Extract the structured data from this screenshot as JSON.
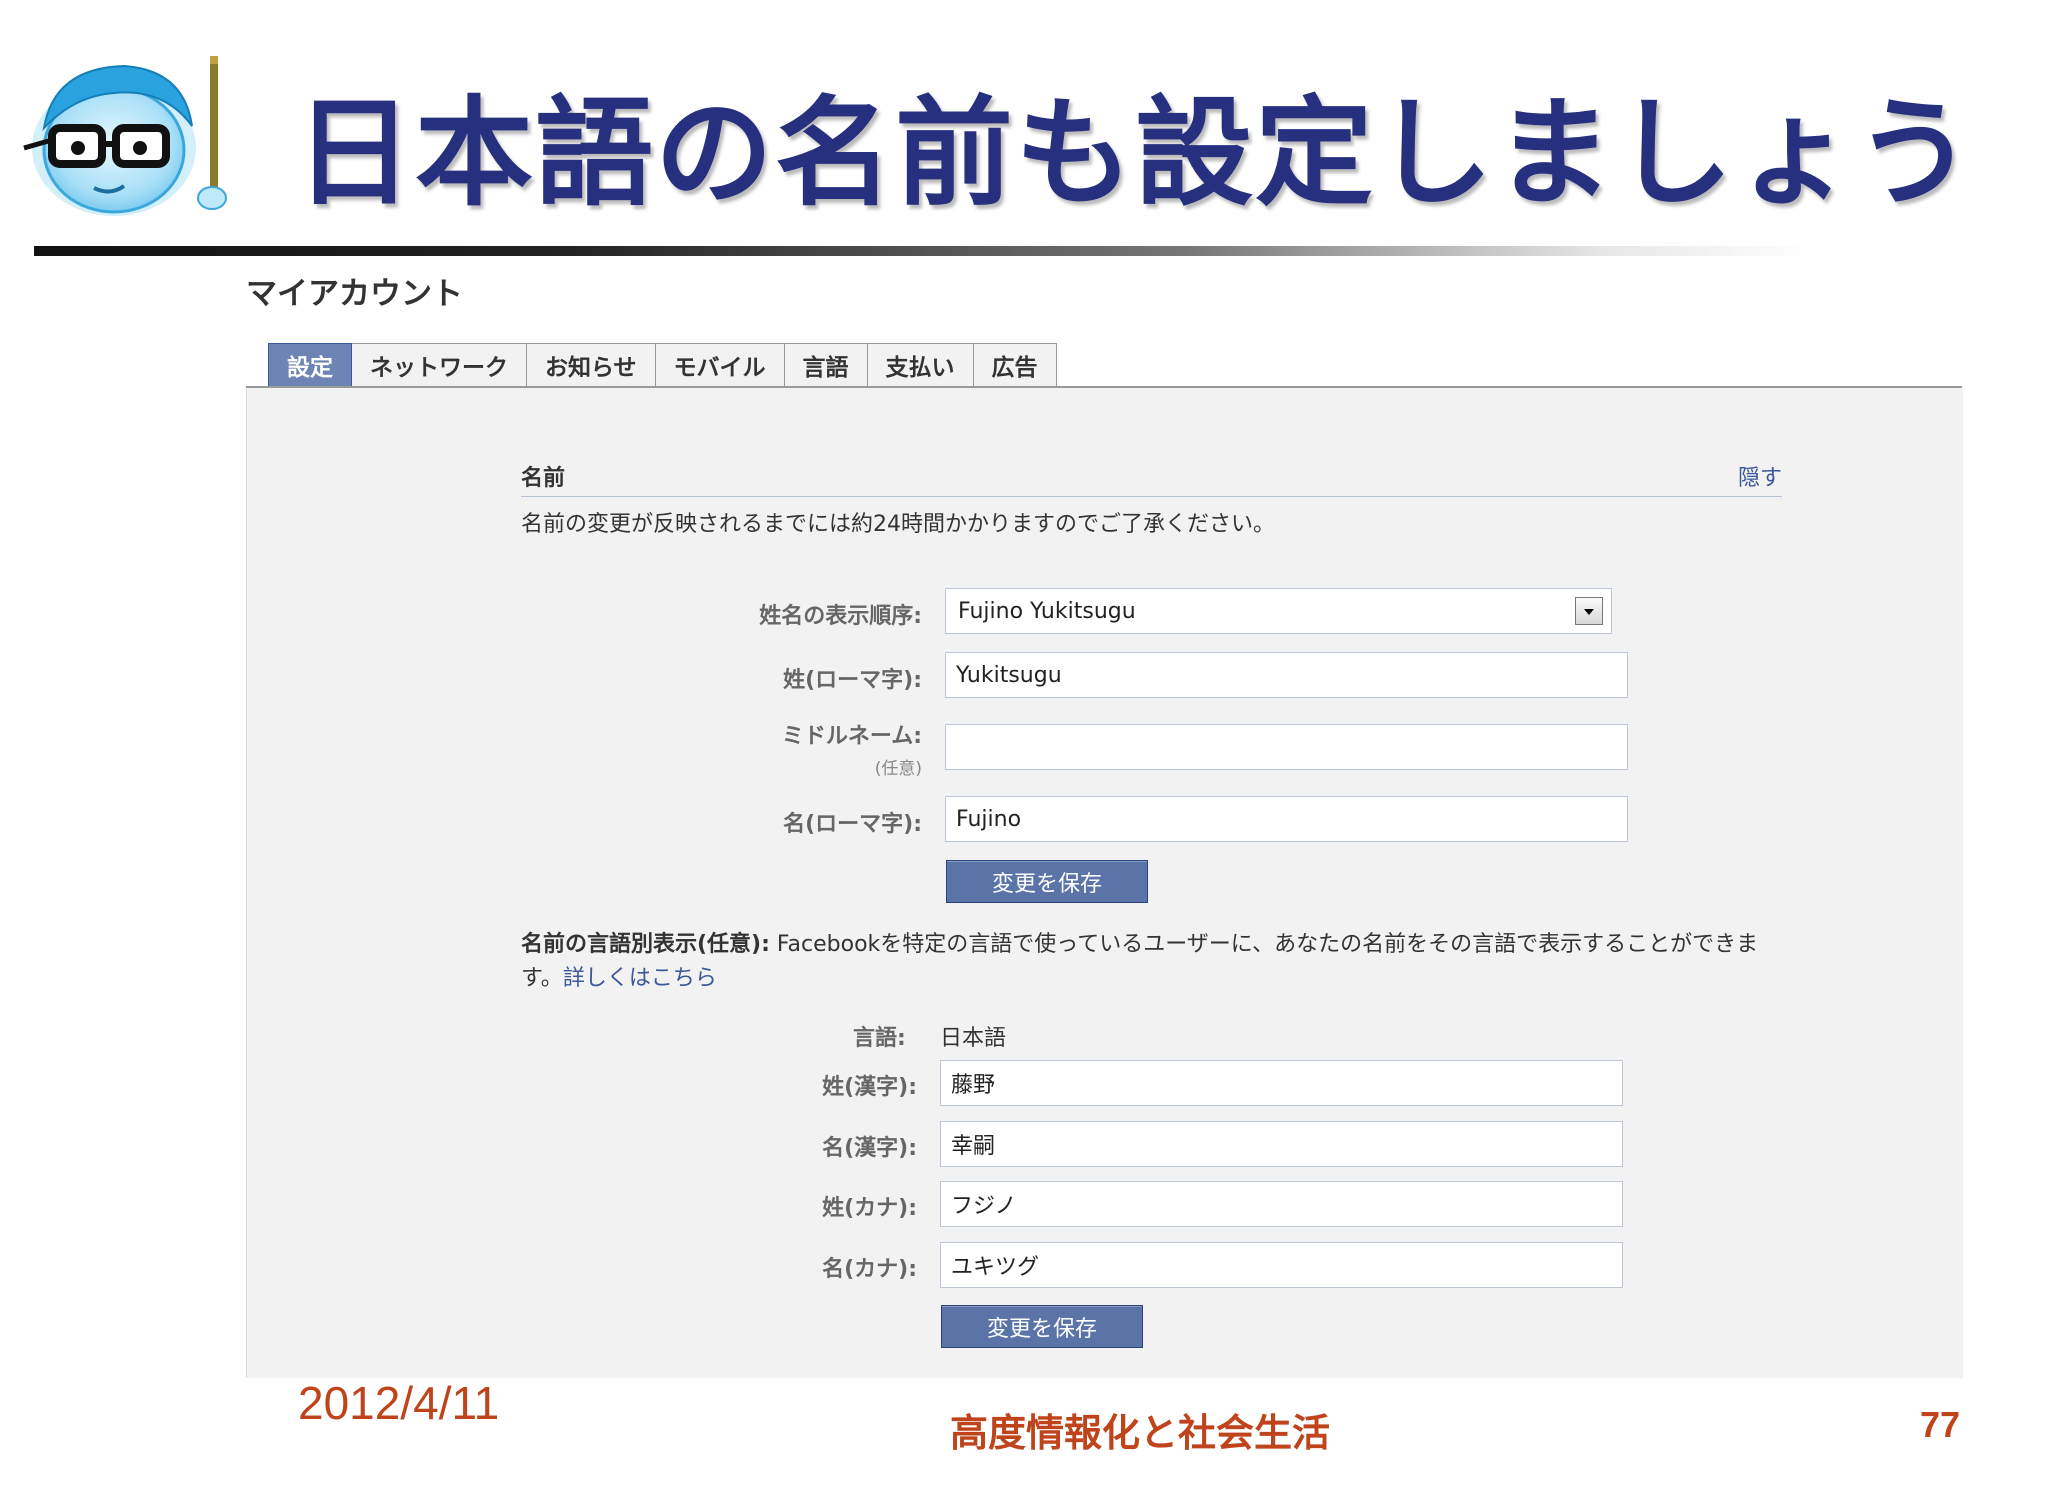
{
  "slide": {
    "title": "日本語の名前も設定しましょう",
    "date": "2012/4/11",
    "footer": "高度情報化と社会生活",
    "page": "77"
  },
  "account": {
    "title": "マイアカウント",
    "tabs": [
      {
        "label": "設定",
        "active": true
      },
      {
        "label": "ネットワーク"
      },
      {
        "label": "お知らせ"
      },
      {
        "label": "モバイル"
      },
      {
        "label": "言語"
      },
      {
        "label": "支払い"
      },
      {
        "label": "広告"
      }
    ]
  },
  "name_section": {
    "title": "名前",
    "hide_link": "隠す",
    "notice": "名前の変更が反映されるまでには約24時間かかりますのでご了承ください。",
    "display_order": {
      "label": "姓名の表示順序:",
      "value": "Fujino Yukitsugu"
    },
    "last_name": {
      "label": "姓(ローマ字):",
      "value": "Yukitsugu"
    },
    "middle_name": {
      "label": "ミドルネーム:",
      "sublabel": "(任意)",
      "value": ""
    },
    "first_name": {
      "label": "名(ローマ字):",
      "value": "Fujino"
    },
    "save_label": "変更を保存"
  },
  "alt_section": {
    "desc_bold": "名前の言語別表示(任意):",
    "desc_text": " Facebookを特定の言語で使っているユーザーに、あなたの名前をその言語で表示することができます。",
    "desc_link": "詳しくはこちら",
    "language": {
      "label": "言語:",
      "value": "日本語"
    },
    "last_kanji": {
      "label": "姓(漢字):",
      "value": "藤野"
    },
    "first_kanji": {
      "label": "名(漢字):",
      "value": "幸嗣"
    },
    "last_kana": {
      "label": "姓(カナ):",
      "value": "フジノ"
    },
    "first_kana": {
      "label": "名(カナ):",
      "value": "ユキツグ"
    },
    "save_label": "変更を保存"
  },
  "colors": {
    "title": "#26307f",
    "footer": "#c0441b",
    "fb_blue": "#3b5998",
    "tab_active": "#6d84b4"
  }
}
